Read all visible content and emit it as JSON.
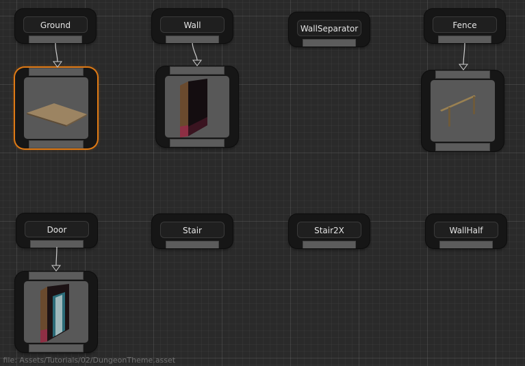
{
  "markers": [
    {
      "label": "Ground"
    },
    {
      "label": "Wall"
    },
    {
      "label": "WallSeparator"
    },
    {
      "label": "Fence"
    },
    {
      "label": "Door"
    },
    {
      "label": "Stair"
    },
    {
      "label": "Stair2X"
    },
    {
      "label": "WallHalf"
    }
  ],
  "visual_nodes": [
    {
      "mesh": "floor-tile",
      "selected": true
    },
    {
      "mesh": "wall-segment",
      "selected": false
    },
    {
      "mesh": "fence-rail",
      "selected": false
    },
    {
      "mesh": "door-frame",
      "selected": false
    }
  ],
  "status": {
    "text": "g file: Assets/Tutorials/02/DungeonTheme.asset"
  },
  "colors": {
    "selection": "#e07a14",
    "canvas": "#2a2a2a",
    "node": "#161616"
  }
}
